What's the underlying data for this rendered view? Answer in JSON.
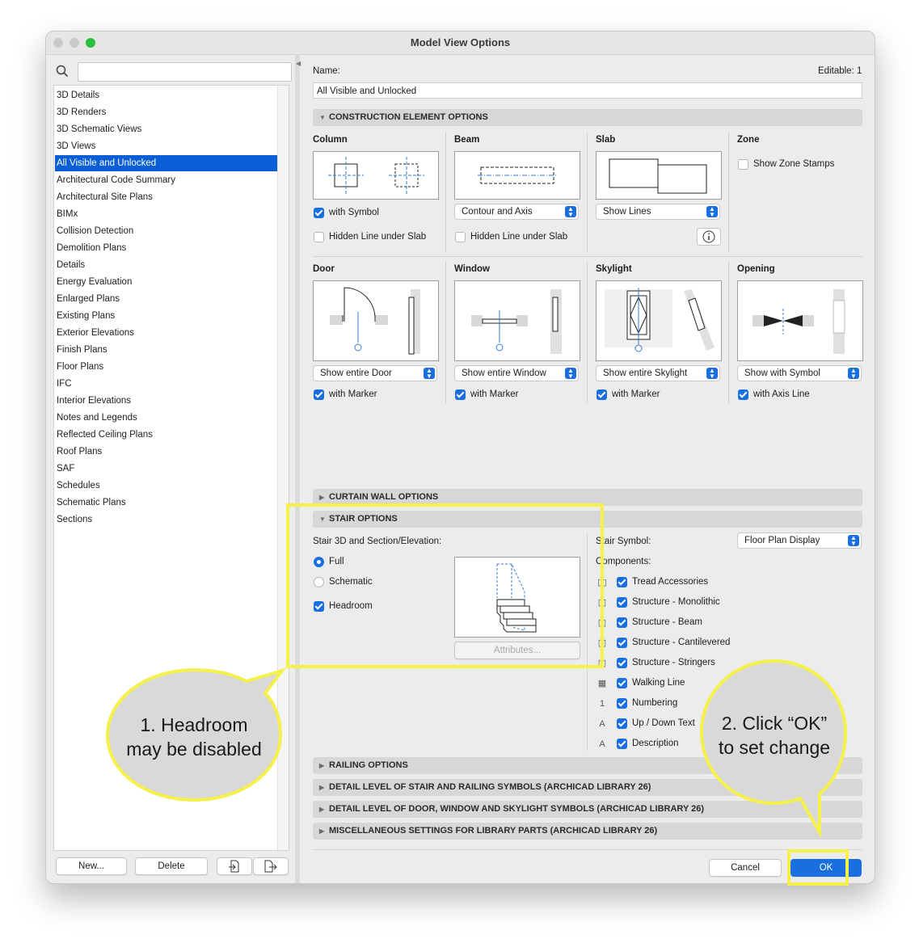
{
  "window": {
    "title": "Model View Options"
  },
  "sidebar": {
    "search_placeholder": "",
    "items": [
      "3D Details",
      "3D Renders",
      "3D Schematic Views",
      "3D Views",
      "All Visible and Unlocked",
      "Architectural Code Summary",
      "Architectural Site Plans",
      "BIMx",
      "Collision Detection",
      "Demolition Plans",
      "Details",
      "Energy Evaluation",
      "Enlarged Plans",
      "Existing Plans",
      "Exterior Elevations",
      "Finish Plans",
      "Floor Plans",
      "IFC",
      "Interior Elevations",
      "Notes and Legends",
      "Reflected Ceiling Plans",
      "Roof Plans",
      "SAF",
      "Schedules",
      "Schematic Plans",
      "Sections"
    ],
    "selected_index": 4,
    "buttons": {
      "new": "New...",
      "delete": "Delete"
    }
  },
  "header": {
    "name_label": "Name:",
    "editable": "Editable: 1",
    "name_value": "All Visible and Unlocked"
  },
  "construction": {
    "title": "CONSTRUCTION ELEMENT OPTIONS",
    "column": {
      "label": "Column",
      "with_symbol": "with Symbol",
      "hidden_line": "Hidden Line under Slab"
    },
    "beam": {
      "label": "Beam",
      "select": "Contour and Axis",
      "hidden_line": "Hidden Line under Slab"
    },
    "slab": {
      "label": "Slab",
      "select": "Show Lines"
    },
    "zone": {
      "label": "Zone",
      "show_stamps": "Show Zone Stamps"
    },
    "door": {
      "label": "Door",
      "select": "Show entire Door",
      "marker": "with Marker"
    },
    "window": {
      "label": "Window",
      "select": "Show entire Window",
      "marker": "with Marker"
    },
    "skylight": {
      "label": "Skylight",
      "select": "Show entire Skylight",
      "marker": "with Marker"
    },
    "opening": {
      "label": "Opening",
      "select": "Show with Symbol",
      "axis": "with Axis Line"
    }
  },
  "curtain_wall": {
    "title": "CURTAIN WALL OPTIONS"
  },
  "stair": {
    "title": "STAIR OPTIONS",
    "section_label": "Stair 3D and Section/Elevation:",
    "full": "Full",
    "schematic": "Schematic",
    "headroom": "Headroom",
    "attributes": "Attributes...",
    "symbol_label": "Stair Symbol:",
    "symbol_select": "Floor Plan Display",
    "components_label": "Components:",
    "components": [
      "Tread Accessories",
      "Structure - Monolithic",
      "Structure - Beam",
      "Structure - Cantilevered",
      "Structure - Stringers",
      "Walking Line",
      "Numbering",
      "Up / Down Text",
      "Description"
    ]
  },
  "collapsed_sections": [
    "RAILING OPTIONS",
    "DETAIL LEVEL OF STAIR AND RAILING SYMBOLS (ARCHICAD LIBRARY 26)",
    "DETAIL LEVEL OF DOOR, WINDOW AND SKYLIGHT SYMBOLS (ARCHICAD LIBRARY 26)",
    "MISCELLANEOUS SETTINGS FOR LIBRARY PARTS (ARCHICAD LIBRARY 26)"
  ],
  "footer": {
    "cancel": "Cancel",
    "ok": "OK"
  },
  "annotations": {
    "callout1_line1": "1. Headroom",
    "callout1_line2": "may be disabled",
    "callout2_line1": "2. Click “OK”",
    "callout2_line2": "to set change"
  },
  "colors": {
    "accent": "#1a6fe0",
    "selection": "#0a5fd6",
    "highlight": "#f5f04a",
    "bubble": "#d9d9d9"
  }
}
